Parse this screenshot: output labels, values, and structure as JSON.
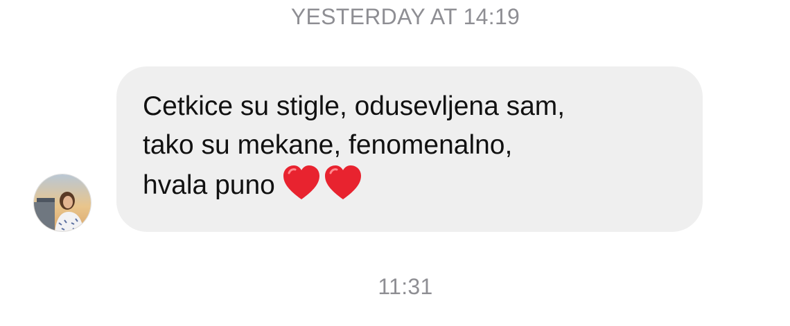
{
  "thread": {
    "timestamp_top": "YESTERDAY AT 14:19",
    "timestamp_bottom": "11:31"
  },
  "message": {
    "sender_avatar_icon": "user-avatar-photo",
    "lines": [
      "Cetkice su stigle, odusevljena sam,",
      "tako su mekane, fenomenalno,",
      "hvala puno"
    ],
    "emoji": [
      "red-heart-icon",
      "red-heart-icon"
    ],
    "bubble_color": "#efefef"
  },
  "colors": {
    "timestamp": "#8e8e93",
    "text": "#111111",
    "heart": "#e8232f"
  }
}
